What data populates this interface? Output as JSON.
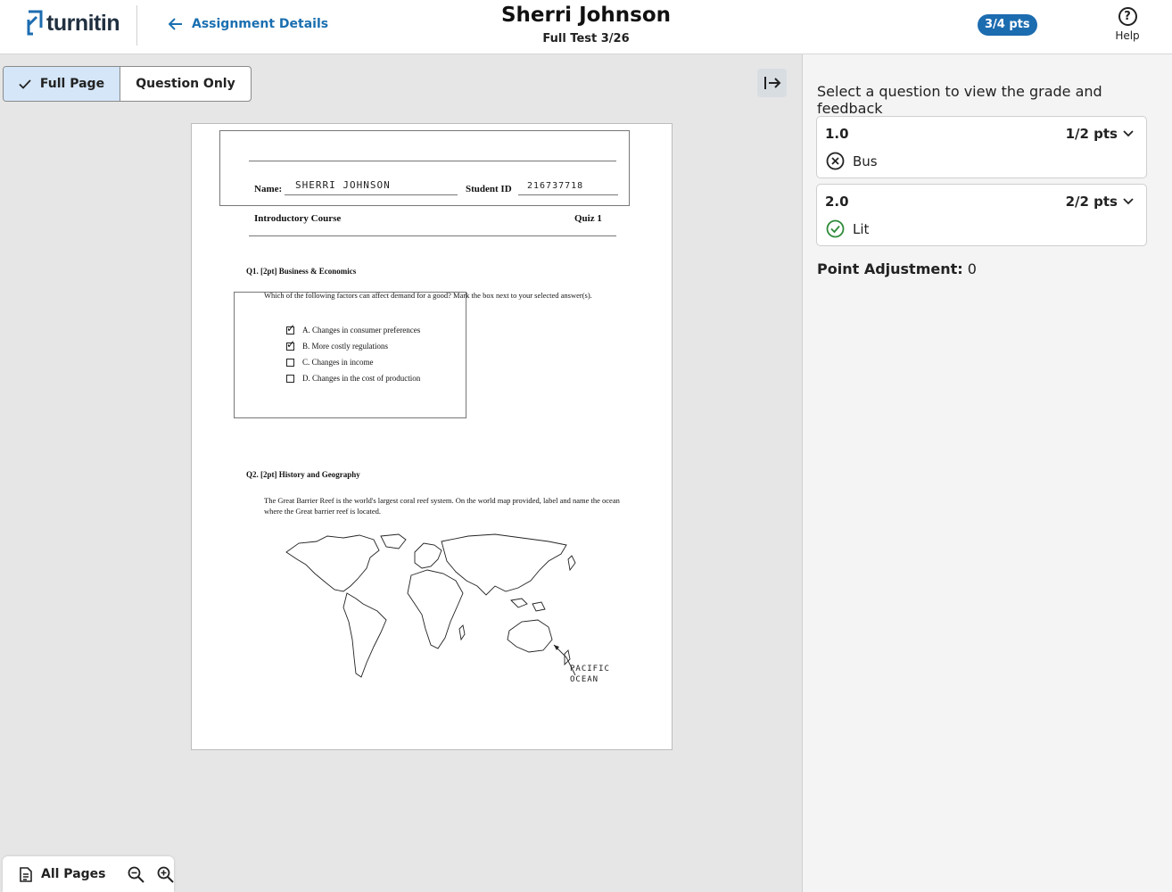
{
  "header": {
    "logo_text": "turnitin",
    "back_label": "Assignment Details",
    "student_name": "Sherri Johnson",
    "test_name": "Full Test 3/26",
    "score": "3/4 pts",
    "help_label": "Help"
  },
  "view_toggle": {
    "full_page": "Full Page",
    "question_only": "Question Only"
  },
  "document": {
    "name_label": "Name:",
    "name_value": "SHERRI   JOHNSON",
    "student_id_label": "Student ID",
    "student_id_value": "216737718",
    "course": "Introductory Course",
    "quiz": "Quiz 1",
    "q1_title": "Q1. [2pt] Business & Economics",
    "q1_text": "Which of the following factors can affect demand for a good? Mark the box next to your selected answer(s).",
    "q1_options": [
      {
        "label": "A.  Changes in consumer preferences",
        "checked": true
      },
      {
        "label": "B.  More costly regulations",
        "checked": true
      },
      {
        "label": "C.  Changes in income",
        "checked": false
      },
      {
        "label": "D.  Changes in the cost of production",
        "checked": false
      }
    ],
    "q2_title": "Q2. [2pt] History and Geography",
    "q2_text": "The Great Barrier Reef is the world's largest coral reef system. On the world map provided, label and name the ocean where the Great barrier reef is located.",
    "map_annotation_1": "PACIFIC",
    "map_annotation_2": "OCEAN"
  },
  "panel": {
    "title": "Select a question to view the grade and feedback",
    "questions": [
      {
        "number": "1.0",
        "points": "1/2 pts",
        "tag": "Bus",
        "status": "incorrect"
      },
      {
        "number": "2.0",
        "points": "2/2 pts",
        "tag": "Lit",
        "status": "correct"
      }
    ],
    "point_adjustment_label": "Point Adjustment:",
    "point_adjustment_value": "0"
  },
  "bottom_bar": {
    "all_pages": "All Pages"
  },
  "colors": {
    "accent": "#1c6cb0",
    "correct": "#2e8b3a",
    "incorrect": "#222222",
    "toggle_active": "#d4e6f7"
  }
}
